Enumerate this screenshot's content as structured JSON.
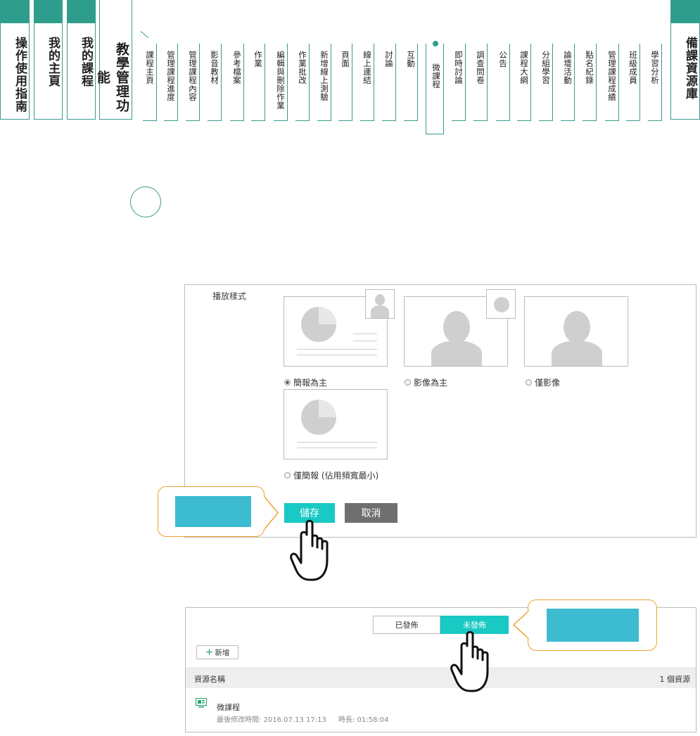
{
  "nav": {
    "big_tabs": [
      {
        "label": "操作使用指南"
      },
      {
        "label": "我的主頁"
      },
      {
        "label": "我的課程"
      },
      {
        "label": "教學管理功能"
      },
      {
        "label": "備課資源庫"
      }
    ],
    "sub_tabs": [
      "課程主頁",
      "管理課程進度",
      "管理課程內容",
      "影音教材",
      "參考檔案",
      "作業",
      "編輯與刪除作業",
      "作業批改",
      "新增線上測驗",
      "頁面",
      "線上連結",
      "討論",
      "互動",
      "微課程",
      "即時討論",
      "調查問卷",
      "公告",
      "課程大綱",
      "分組學習",
      "論壇活動",
      "點名紀錄",
      "管理課程成績",
      "班級成員",
      "學習分析"
    ],
    "active_sub_tab": "微課程"
  },
  "settings": {
    "label": "播放樣式",
    "options": [
      {
        "label": "簡報為主",
        "checked": true
      },
      {
        "label": "影像為主",
        "checked": false
      },
      {
        "label": "僅影像",
        "checked": false
      },
      {
        "label": "僅簡報 (佔用頻寬最小)",
        "checked": false
      }
    ],
    "save_label": "儲存",
    "cancel_label": "取消"
  },
  "resources": {
    "tab_published": "已發佈",
    "tab_unpublished": "未發佈",
    "add_label": "新增",
    "col_name": "資源名稱",
    "count": "1 個資源",
    "items": [
      {
        "title": "微課程",
        "modified": "最後修改時間: 2016.07.13 17:13",
        "duration": "時長: 01:58:04"
      }
    ]
  },
  "colors": {
    "accent": "#19c9c4",
    "nav": "#2f9d8c",
    "callout": "#f0a230",
    "callout_fill": "#3dbbd0"
  }
}
